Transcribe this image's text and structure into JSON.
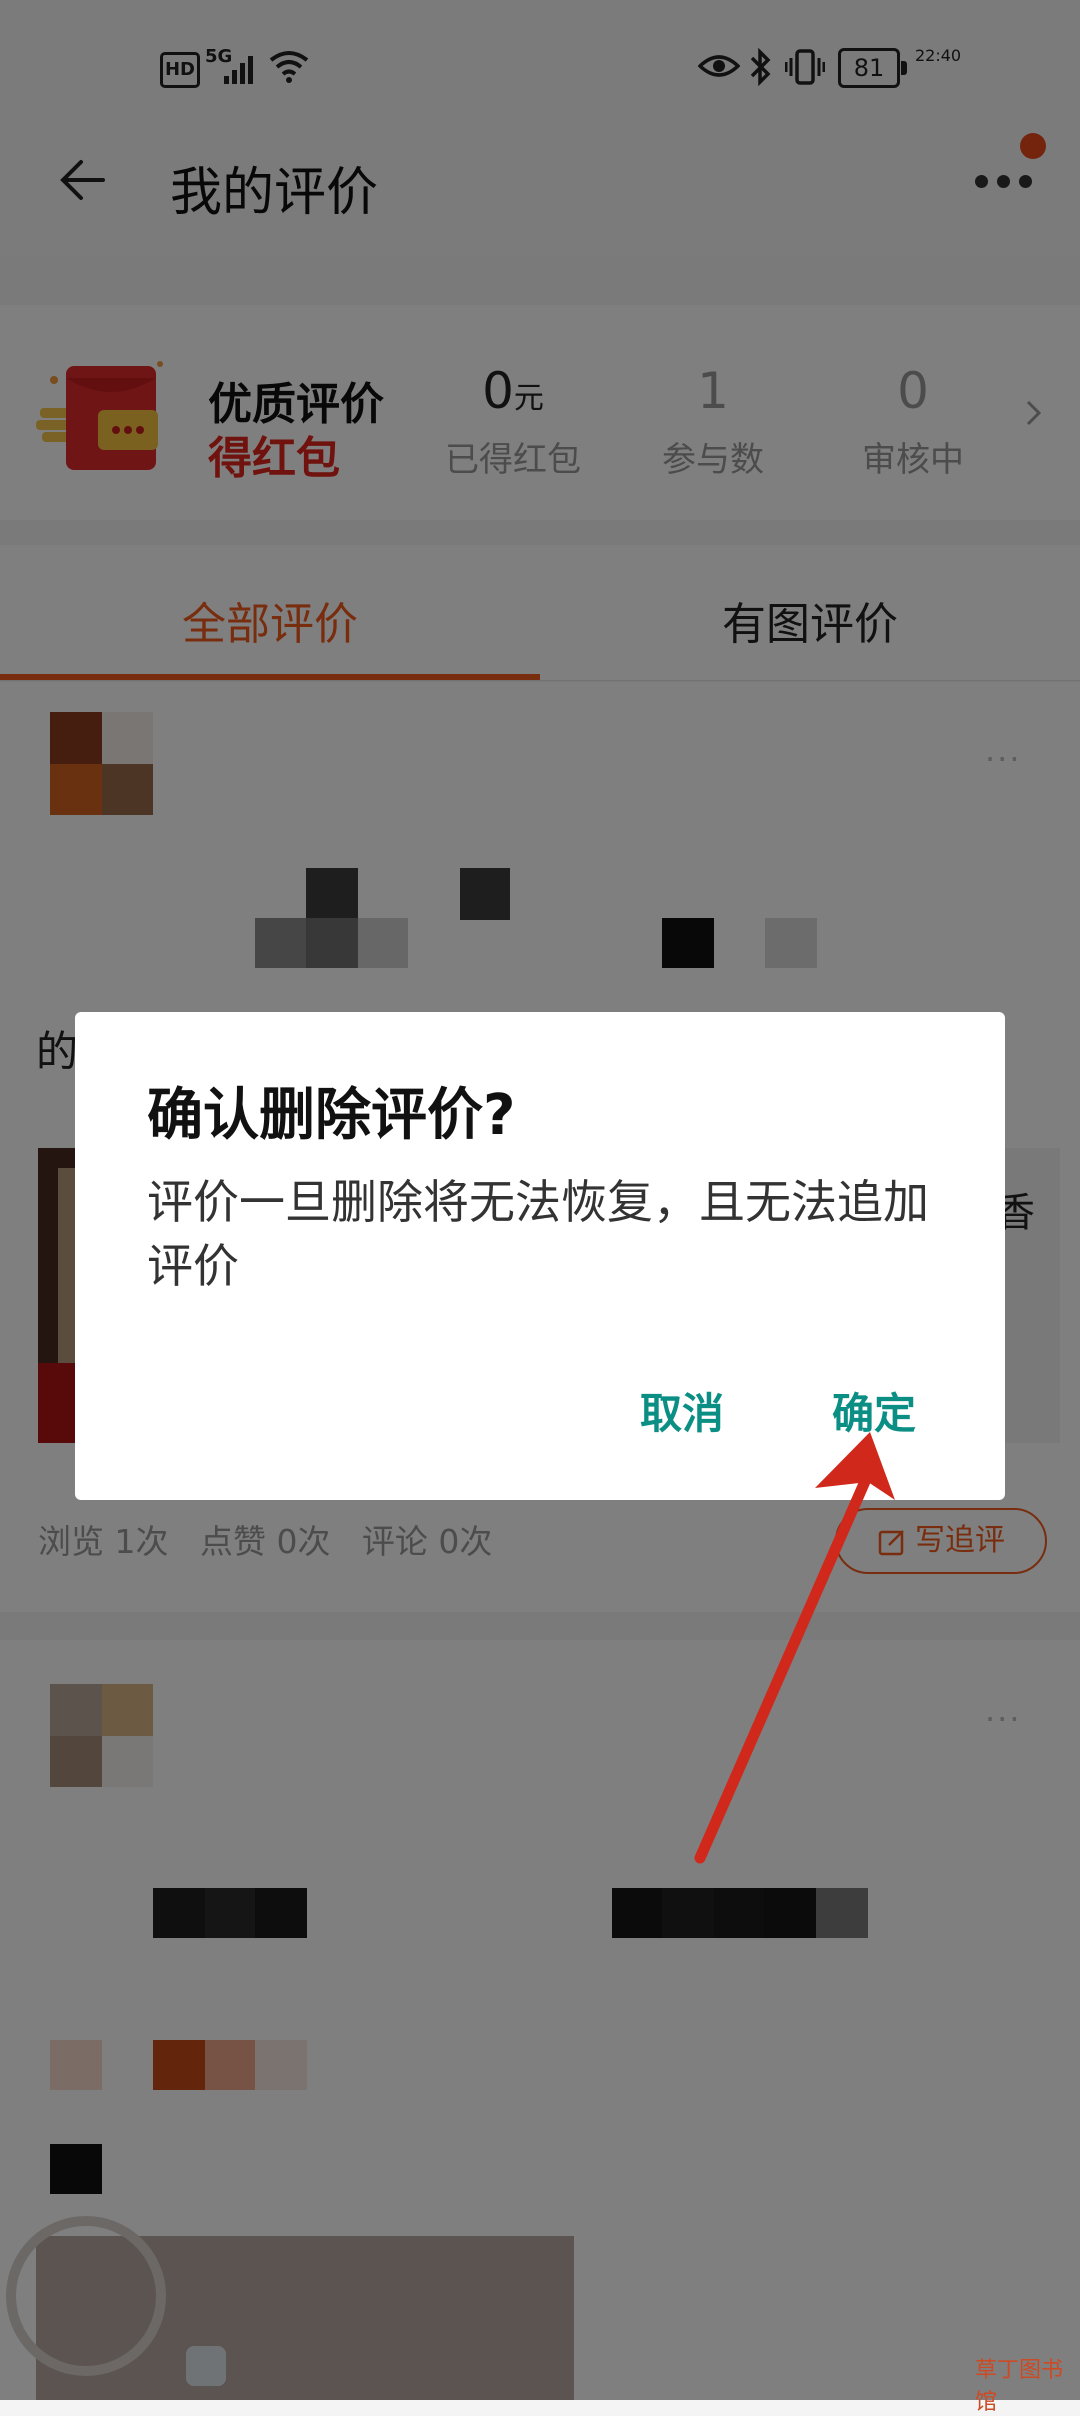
{
  "status_bar": {
    "hd": "HD",
    "network": "5G",
    "battery": "81",
    "time": "22:40"
  },
  "header": {
    "title": "我的评价"
  },
  "reward": {
    "title_line1": "优质评价",
    "title_line2": "得红包",
    "stats": [
      {
        "value": "0",
        "unit": "元",
        "label": "已得红包"
      },
      {
        "value": "1",
        "unit": "",
        "label": "参与数"
      },
      {
        "value": "0",
        "unit": "",
        "label": "审核中"
      }
    ]
  },
  "tabs": [
    {
      "label": "全部评价",
      "active": true
    },
    {
      "label": "有图评价",
      "active": false
    }
  ],
  "review": {
    "snippet_start": "的",
    "snippet_end": "香",
    "stats_text": "浏览 1次   点赞 0次   评论 0次",
    "follow_label": "写追评"
  },
  "dialog": {
    "title": "确认删除评价?",
    "message": "评价一旦删除将无法恢复，且无法追加评价",
    "cancel_label": "取消",
    "confirm_label": "确定"
  },
  "watermark": "草丁图书馆",
  "colors": {
    "accent": "#f25a1e",
    "dialog_button": "#0b8f84",
    "annotation_arrow": "#d0281b",
    "reward_red": "#e1251b"
  },
  "icons": [
    "back-arrow-icon",
    "more-dots-icon",
    "red-packet-icon",
    "chevron-right-icon",
    "edit-icon",
    "wifi-icon",
    "signal-icon",
    "bluetooth-icon",
    "eye-icon",
    "vibrate-icon"
  ]
}
